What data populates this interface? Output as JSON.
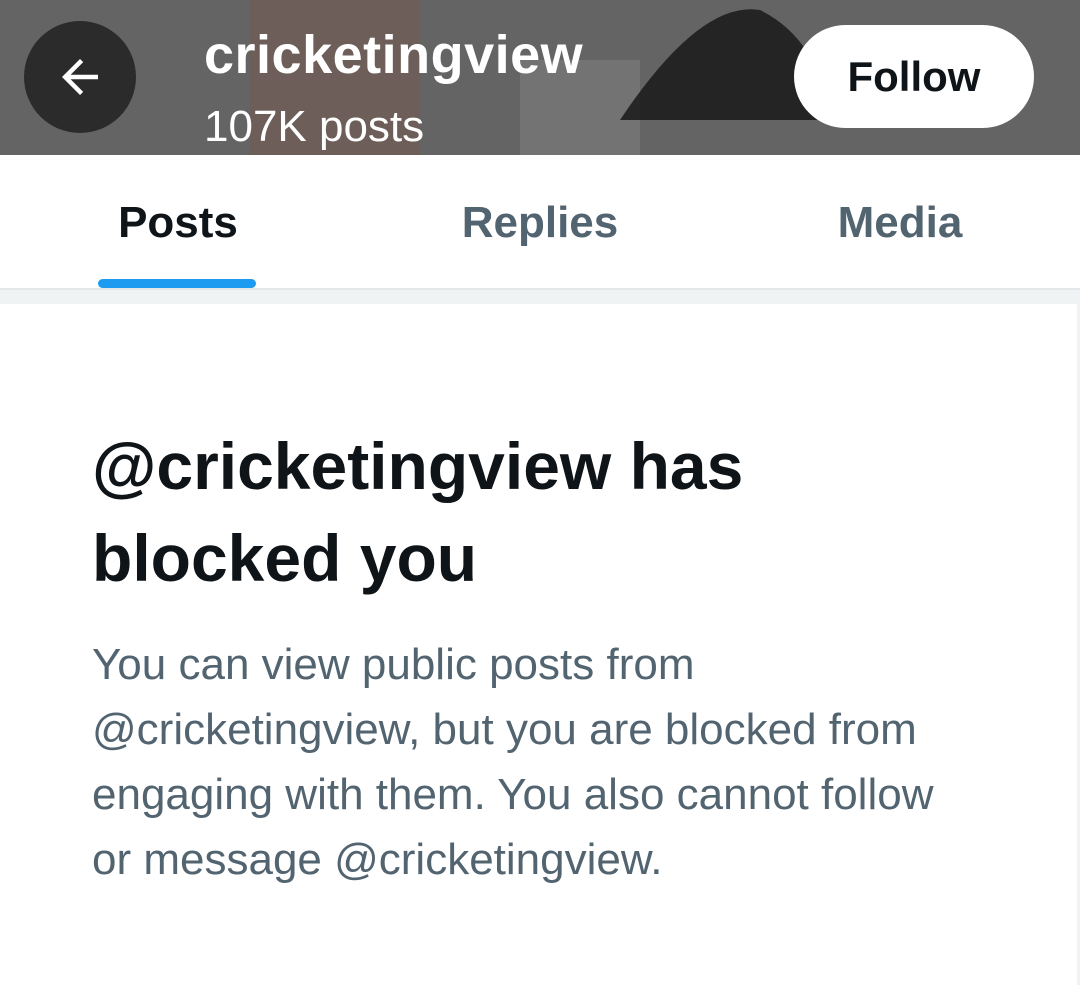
{
  "header": {
    "profile_name": "cricketingview",
    "post_count": "107K posts",
    "follow_label": "Follow"
  },
  "tabs": [
    {
      "label": "Posts",
      "active": true
    },
    {
      "label": "Replies",
      "active": false
    },
    {
      "label": "Media",
      "active": false
    }
  ],
  "blocked_notice": {
    "title": "@cricketingview has blocked you",
    "description": "You can view public posts from @cricketingview, but you are blocked from engaging with them. You also cannot follow or message @cricketingview."
  },
  "icons": {
    "back": "arrow-left-icon"
  },
  "colors": {
    "accent": "#1d9bf0",
    "primary_text": "#0f1419",
    "secondary_text": "#536471",
    "back_button_bg": "#2b2b2b"
  }
}
